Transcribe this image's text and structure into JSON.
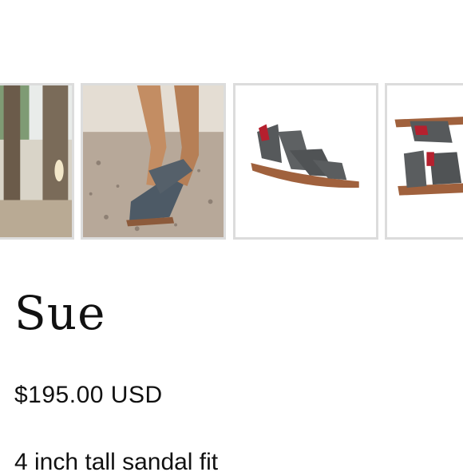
{
  "gallery": {
    "images": [
      {
        "alt": "lifestyle-tree-outdoor"
      },
      {
        "alt": "model-wearing-sandals-gravel"
      },
      {
        "alt": "sandal-side-view"
      },
      {
        "alt": "sandal-angle-view"
      }
    ]
  },
  "product": {
    "title": "Sue",
    "price": "$195.00 USD",
    "description_snippet": "4 inch tall sandal fit"
  },
  "colors": {
    "thumb_border": "#dcdcdc",
    "leather_grey": "#56595b",
    "sole_tan": "#a0613d",
    "lining_red": "#b5202e"
  }
}
